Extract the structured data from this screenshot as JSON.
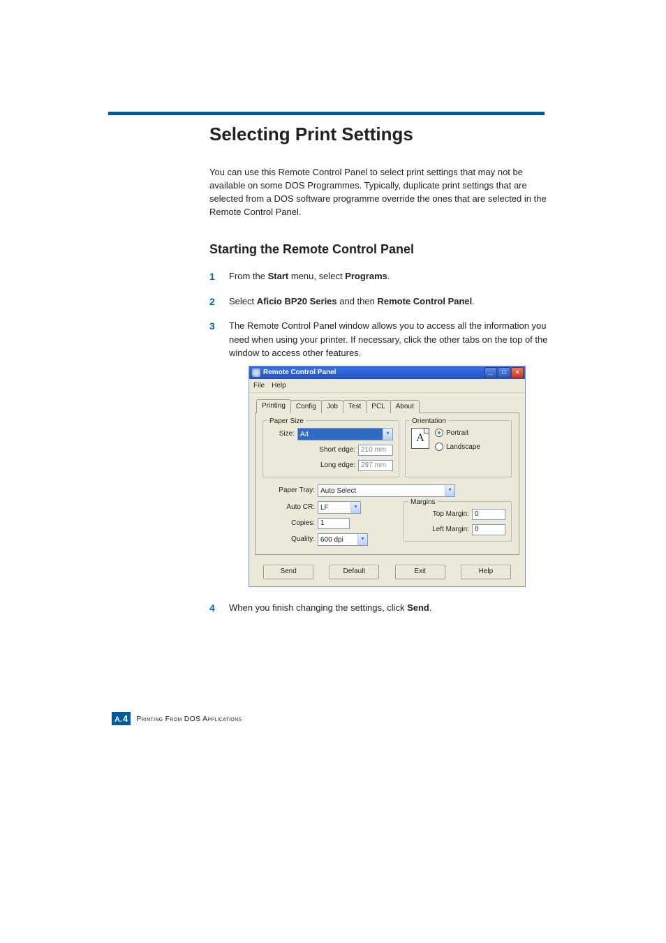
{
  "page": {
    "title": "Selecting Print Settings",
    "intro": "You can use this Remote Control Panel to select print settings that may not be available on some DOS Programmes. Typically, duplicate print settings that are selected from a DOS software programme override the ones that are selected in the Remote Control Panel.",
    "subheading": "Starting the Remote Control Panel"
  },
  "steps": {
    "s1_a": "From the ",
    "s1_b": "Start",
    "s1_c": " menu, select ",
    "s1_d": "Programs",
    "s1_e": ".",
    "s2_a": "Select ",
    "s2_b": "Aficio BP20 Series",
    "s2_c": " and then ",
    "s2_d": "Remote Control Panel",
    "s2_e": ".",
    "s3": "The Remote Control Panel window allows you to access all the information you need when using your printer. If necessary, click the other tabs on the top of the window to access other features.",
    "s4_a": "When you finish changing the settings, click ",
    "s4_b": "Send",
    "s4_c": "."
  },
  "nums": {
    "n1": "1",
    "n2": "2",
    "n3": "3",
    "n4": "4"
  },
  "window": {
    "title": "Remote Control Panel",
    "min": "_",
    "max": "□",
    "close": "×",
    "menu_file": "File",
    "menu_help": "Help",
    "tabs": {
      "printing": "Printing",
      "config": "Config",
      "job": "Job",
      "test": "Test",
      "pcl": "PCL",
      "about": "About"
    },
    "papersize": {
      "legend": "Paper Size",
      "size_label": "Size:",
      "size_value": "A4",
      "shortedge_label": "Short edge:",
      "shortedge_value": "210 mm",
      "longedge_label": "Long edge:",
      "longedge_value": "297 mm"
    },
    "orientation": {
      "legend": "Orientation",
      "icon_letter": "A",
      "portrait": "Portrait",
      "landscape": "Landscape"
    },
    "opts": {
      "papertray_label": "Paper Tray:",
      "papertray_value": "Auto Select",
      "autocr_label": "Auto CR:",
      "autocr_value": "LF",
      "copies_label": "Copies:",
      "copies_value": "1",
      "quality_label": "Quality:",
      "quality_value": "600 dpi"
    },
    "margins": {
      "legend": "Margins",
      "top_label": "Top Margin:",
      "top_value": "0",
      "left_label": "Left Margin:",
      "left_value": "0"
    },
    "buttons": {
      "send": "Send",
      "default": "Default",
      "exit": "Exit",
      "help": "Help"
    }
  },
  "footer": {
    "badge_prefix": "A.",
    "badge_num": "4",
    "text": "Printing From DOS Applications"
  },
  "chevron": "▾"
}
